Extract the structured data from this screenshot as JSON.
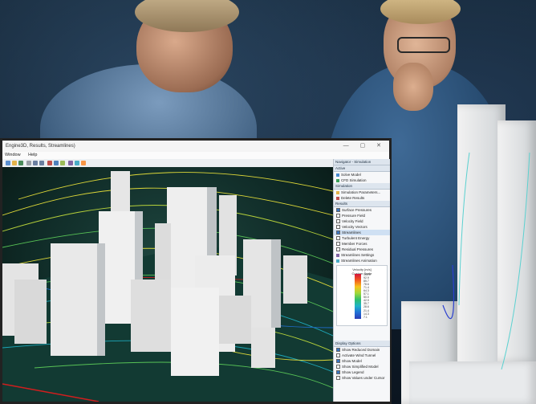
{
  "window": {
    "title": "Engine3D, Results, Streamlines)",
    "menu": [
      "Window",
      "Help"
    ],
    "controls": "—  ▢  ✕"
  },
  "panel": {
    "tab_title": "Navigator - Simulation",
    "sections": [
      {
        "header": "Active",
        "items": [
          "Solve Model",
          "CFD Simulation"
        ]
      },
      {
        "header": "Simulation",
        "items": [
          "Simulation Parameters...",
          "Delete Results"
        ]
      },
      {
        "header": "Results",
        "items": [
          "Surface Pressures",
          "Pressure Field",
          "Velocity Field",
          "Velocity Vectors",
          "Streamlines",
          "Turbulent Energy",
          "Member Forces",
          "Residual Pressures",
          "Streamlines Settings",
          "Streamlines Animation"
        ]
      }
    ],
    "selected_item": "Streamlines",
    "legend": {
      "title": "Velocity [m/s]",
      "subtitle": "Custom Scale",
      "ticks": [
        "100.0",
        "92.9",
        "85.7",
        "78.6",
        "71.4",
        "64.3",
        "57.1",
        "50.0",
        "42.9",
        "35.7",
        "28.6",
        "21.4",
        "14.3",
        "7.1",
        "0.0"
      ]
    },
    "display": {
      "header": "Display Options",
      "options": [
        {
          "label": "Show Reduced Domain",
          "checked": true
        },
        {
          "label": "Activate Wind Tunnel",
          "checked": false
        },
        {
          "label": "Show Model",
          "checked": true
        },
        {
          "label": "Show Simplified Model",
          "checked": false
        },
        {
          "label": "Show Legend",
          "checked": true
        },
        {
          "label": "Show Values under Cursor",
          "checked": false
        }
      ]
    }
  },
  "colors": {
    "streamline_high": "#f2e93a",
    "streamline_mid": "#5fd15a",
    "streamline_low": "#1fb3c8",
    "ground": "#123a33",
    "selection": "#cfe0f3"
  }
}
